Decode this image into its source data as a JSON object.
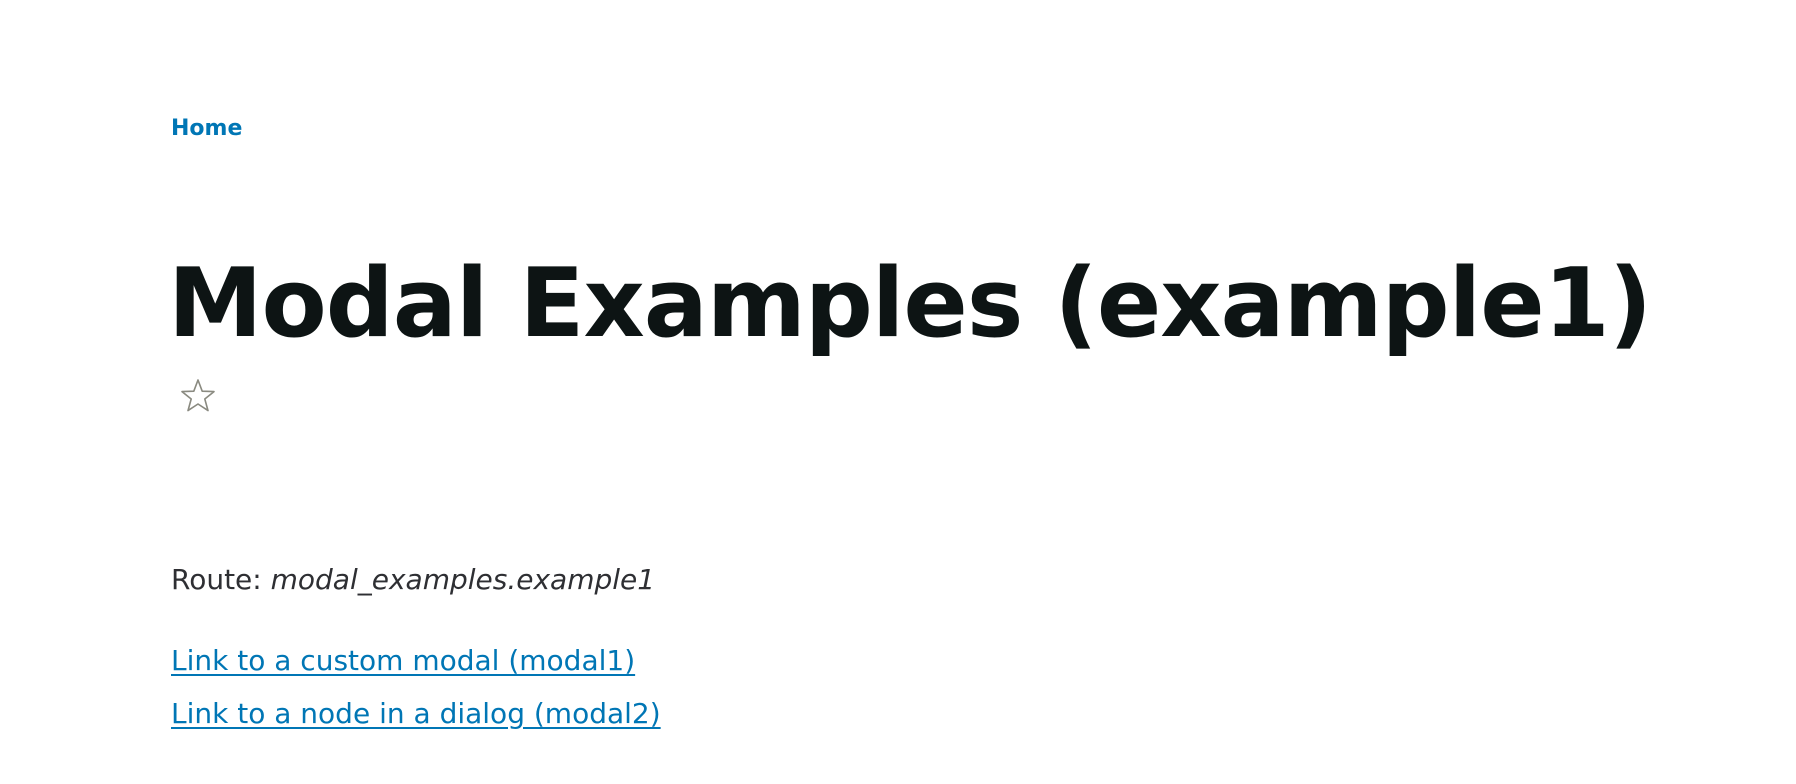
{
  "breadcrumb": {
    "items": [
      {
        "label": "Home"
      }
    ]
  },
  "page": {
    "title": "Modal Examples (example1)",
    "favorite_icon": "star-outline-icon"
  },
  "content": {
    "route_label": "Route:",
    "route_value": "modal_examples.example1",
    "links": [
      {
        "label": "Link to a custom modal (modal1)"
      },
      {
        "label": "Link to a node in a dialog (modal2)"
      }
    ]
  },
  "colors": {
    "link": "#0076b5",
    "title": "#0d1414",
    "text": "#2e2f33",
    "star_stroke": "#8a8a80"
  }
}
